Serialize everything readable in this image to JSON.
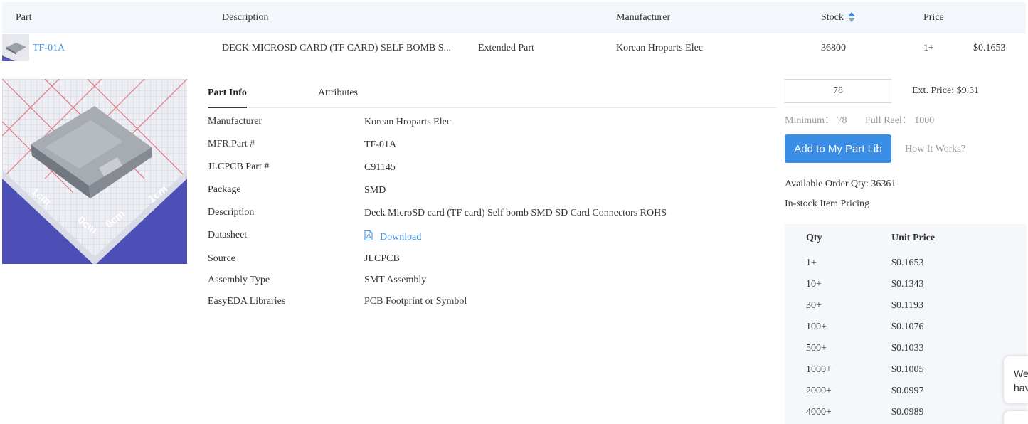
{
  "header": {
    "part": "Part",
    "description": "Description",
    "manufacturer": "Manufacturer",
    "stock": "Stock",
    "price": "Price"
  },
  "row": {
    "part": "TF-01A",
    "description": "DECK MICROSD CARD (TF CARD) SELF BOMB S...",
    "type": "Extended Part",
    "manufacturer": "Korean Hroparts Elec",
    "stock": "36800",
    "qty": "1+",
    "price": "$0.1653"
  },
  "tabs": [
    "Part Info",
    "Attributes"
  ],
  "info": {
    "manufacturer": {
      "label": "Manufacturer",
      "value": "Korean Hroparts Elec"
    },
    "mfr_part": {
      "label": "MFR.Part #",
      "value": "TF-01A"
    },
    "jlc_part": {
      "label": "JLCPCB Part #",
      "value": "C91145"
    },
    "package": {
      "label": "Package",
      "value": "SMD"
    },
    "description": {
      "label": "Description",
      "value": "Deck MicroSD card (TF card) Self bomb SMD SD Card Connectors ROHS"
    },
    "datasheet": {
      "label": "Datasheet",
      "value": "Download"
    },
    "source": {
      "label": "Source",
      "value": "JLCPCB"
    },
    "assembly": {
      "label": "Assembly Type",
      "value": "SMT Assembly"
    },
    "easyeda": {
      "label": "EasyEDA Libraries",
      "value": "PCB Footprint or Symbol"
    }
  },
  "order": {
    "quantity": "78",
    "ext_price": "Ext. Price: $9.31",
    "minimum_label": "Minimum：",
    "minimum": "78",
    "full_reel_label": "Full Reel：",
    "full_reel": "1000",
    "add_button": "Add to My Part Lib",
    "how_it_works": "How It Works?",
    "available": "Available Order Qty: 36361",
    "instock_pricing": "In-stock Item Pricing"
  },
  "price_table": {
    "headers": [
      "Qty",
      "Unit Price"
    ],
    "rows": [
      [
        "1+",
        "$0.1653"
      ],
      [
        "10+",
        "$0.1343"
      ],
      [
        "30+",
        "$0.1193"
      ],
      [
        "100+",
        "$0.1076"
      ],
      [
        "500+",
        "$0.1033"
      ],
      [
        "1000+",
        "$0.1005"
      ],
      [
        "2000+",
        "$0.0997"
      ],
      [
        "4000+",
        "$0.0989"
      ]
    ]
  },
  "chat": {
    "line1": "We",
    "line2": "hav"
  },
  "colors": {
    "accent": "#3a8ee6",
    "header_bg": "#f3f6fb",
    "price_bg": "#f5f7fa"
  },
  "icons": {
    "sort": "sort-icon",
    "pdf": "pdf-icon"
  }
}
